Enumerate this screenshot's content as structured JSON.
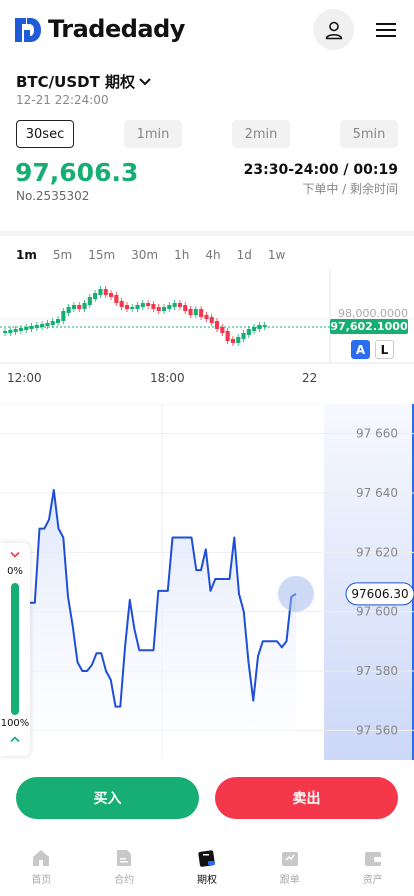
{
  "app": {
    "name": "Tradedady"
  },
  "market": {
    "pair": "BTC/USDT 期权",
    "datetime": "12-21 22:24:00"
  },
  "periods": [
    {
      "label": "30sec",
      "active": true
    },
    {
      "label": "1min"
    },
    {
      "label": "2min"
    },
    {
      "label": "5min"
    }
  ],
  "quote": {
    "price": "97,606.3",
    "order_no": "No.2535302",
    "time_range": "23:30-24:00 / 00:19",
    "time_note": "下单中 / 剩余时间"
  },
  "timeframes": [
    "1m",
    "5m",
    "15m",
    "30m",
    "1h",
    "4h",
    "1d",
    "1w"
  ],
  "mini_chart": {
    "price_tag": "97,602.1000",
    "level_label": "98,000.0000",
    "x_labels": [
      "12:00",
      "18:00",
      "22"
    ],
    "btn_a": "A",
    "btn_l": "L",
    "bull_color": "#16ae72",
    "bear_color": "#f5374b"
  },
  "chart_data": {
    "type": "line",
    "y_ticks": [
      "97 660",
      "97 640",
      "97 620",
      "97 600",
      "97 580",
      "97 560"
    ],
    "ylim": [
      97550,
      97670
    ],
    "current_value": "97606.30",
    "line_color": "#1f4fd8",
    "values": [
      97603,
      97603,
      97628,
      97628,
      97631,
      97641,
      97628,
      97625,
      97605,
      97595,
      97583,
      97580,
      97580,
      97582,
      97586,
      97586,
      97580,
      97577,
      97568,
      97568,
      97588,
      97604,
      97594,
      97587,
      97587,
      97587,
      97587,
      97607,
      97607,
      97607,
      97625,
      97625,
      97625,
      97625,
      97625,
      97614,
      97614,
      97621,
      97607,
      97611,
      97611,
      97611,
      97611,
      97625,
      97606,
      97600,
      97583,
      97570,
      97585,
      97590,
      97590,
      97590,
      97590,
      97588,
      97590,
      97605,
      97606
    ]
  },
  "side_panel": {
    "top_label": "0%",
    "bottom_label": "100%",
    "level_color": "#16ae72"
  },
  "actions": {
    "buy": "买入",
    "sell": "卖出"
  },
  "tabs": [
    {
      "label": "首页",
      "icon": "home-icon"
    },
    {
      "label": "合约",
      "icon": "contract-icon"
    },
    {
      "label": "期权",
      "icon": "options-icon",
      "active": true
    },
    {
      "label": "跟单",
      "icon": "copy-trade-icon"
    },
    {
      "label": "资产",
      "icon": "wallet-icon"
    }
  ]
}
